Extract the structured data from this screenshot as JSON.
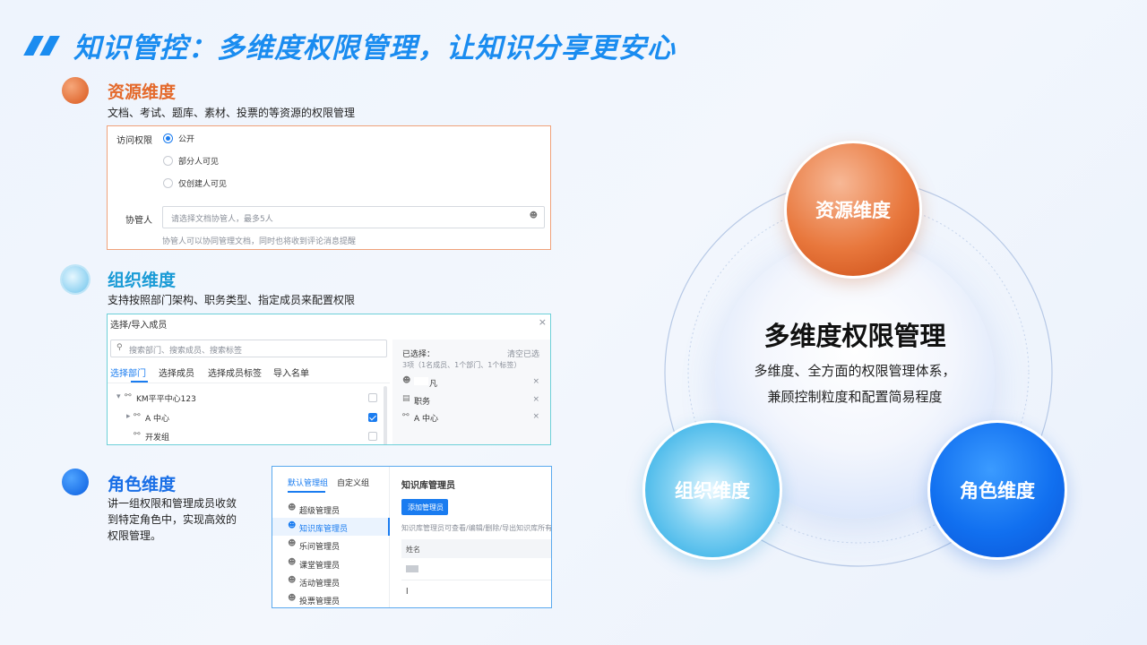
{
  "header": {
    "title": "知识管控：多维度权限管理，让知识分享更安心"
  },
  "sections": {
    "resource": {
      "title": "资源维度",
      "desc": "文档、考试、题库、素材、投票的等资源的权限管理"
    },
    "org": {
      "title": "组织维度",
      "desc": "支持按照部门架构、职务类型、指定成员来配置权限"
    },
    "role": {
      "title": "角色维度",
      "desc_lines": [
        "讲一组权限和管理成员收敛",
        "到特定角色中，实现高效的",
        "权限管理。"
      ]
    }
  },
  "access_panel": {
    "access_label": "访问权限",
    "options": [
      "公开",
      "部分人可见",
      "仅创建人可见"
    ],
    "collab_label": "协管人",
    "collab_placeholder": "请选择文档协管人，最多5人",
    "collab_hint": "协管人可以协同管理文档，同时也将收到评论消息提醒"
  },
  "member_panel": {
    "title": "选择/导入成员",
    "close": "×",
    "search_placeholder": "搜索部门、搜索成员、搜索标签",
    "tabs": [
      "选择部门",
      "选择成员",
      "选择成员标签",
      "导入名单"
    ],
    "tree": [
      {
        "label": "KM平平中心123",
        "arrow": "▾"
      },
      {
        "label": "A 中心",
        "arrow": "▸"
      },
      {
        "label": "开发组",
        "arrow": ""
      }
    ],
    "selected_label": "已选择：",
    "clear_label": "清空已选",
    "selected_count": "3项（1名成员、1个部门、1个标签）",
    "selected_items": [
      {
        "label": "凡"
      },
      {
        "label": "职务"
      },
      {
        "label": "A 中心"
      }
    ]
  },
  "role_panel": {
    "tabs": [
      "默认管理组",
      "自定义组"
    ],
    "roles": [
      "超级管理员",
      "知识库管理员",
      "乐问管理员",
      "课堂管理员",
      "活动管理员",
      "投票管理员"
    ],
    "right_title": "知识库管理员",
    "add_button": "添加管理员",
    "desc": "知识库管理员可查看/编辑/删除/导出知识库所有文档...",
    "col_header": "姓名",
    "rows": [
      "",
      "l"
    ]
  },
  "diagram": {
    "center_title": "多维度权限管理",
    "center_lines": [
      "多维度、全方面的权限管理体系，",
      "兼顾控制粒度和配置简易程度"
    ],
    "nodes": [
      "资源维度",
      "组织维度",
      "角色维度"
    ]
  },
  "colors": {
    "brand": "#1a8cf0",
    "resource": "#e46a2c",
    "org": "#1a9bd6",
    "role": "#1a6fe6"
  }
}
